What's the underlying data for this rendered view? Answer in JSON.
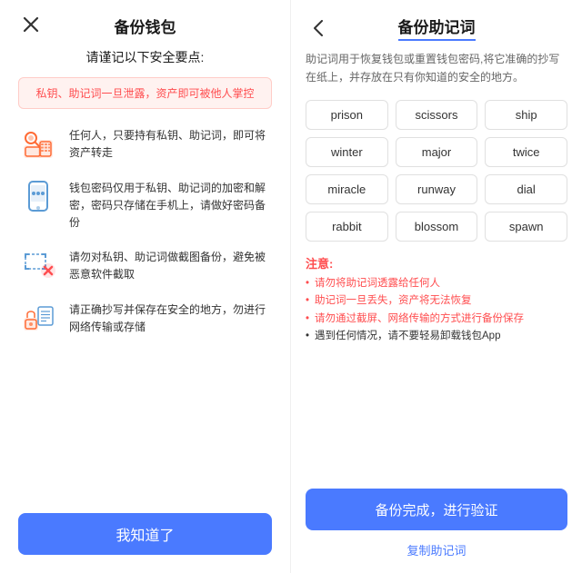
{
  "left": {
    "title": "备份钱包",
    "close_icon": "×",
    "subtitle": "请谨记以下安全要点:",
    "warning": "私钥、助记词一旦泄露，资产即可被他人掌控",
    "security_items": [
      {
        "icon": "key-icon",
        "text": "任何人，只要持有私钥、助记词，即可将资产转走"
      },
      {
        "icon": "phone-icon",
        "text": "钱包密码仅用于私钥、助记词的加密和解密，密码只存储在手机上，请做好密码备份"
      },
      {
        "icon": "screenshot-icon",
        "text": "请勿对私钥、助记词做截图备份，避免被恶意软件截取"
      },
      {
        "icon": "paper-icon",
        "text": "请正确抄写并保存在安全的地方，勿进行网络传输或存储"
      }
    ],
    "confirm_button": "我知道了"
  },
  "right": {
    "title": "备份助记词",
    "back_icon": "‹",
    "description": "助记词用于恢复钱包或重置钱包密码,将它准确的抄写在纸上，并存放在只有你知道的安全的地方。",
    "mnemonic_words": [
      "prison",
      "scissors",
      "ship",
      "winter",
      "major",
      "twice",
      "miracle",
      "runway",
      "dial",
      "rabbit",
      "blossom",
      "spawn"
    ],
    "notes_title": "注意:",
    "notes": [
      "请勿将助记词透露给任何人",
      "助记词一旦丢失，资产将无法恢复",
      "请勿通过截屏、网络传输的方式进行备份保存",
      "遇到任何情况，请不要轻易卸载钱包App"
    ],
    "backup_button": "备份完成，进行验证",
    "copy_link": "复制助记词"
  }
}
